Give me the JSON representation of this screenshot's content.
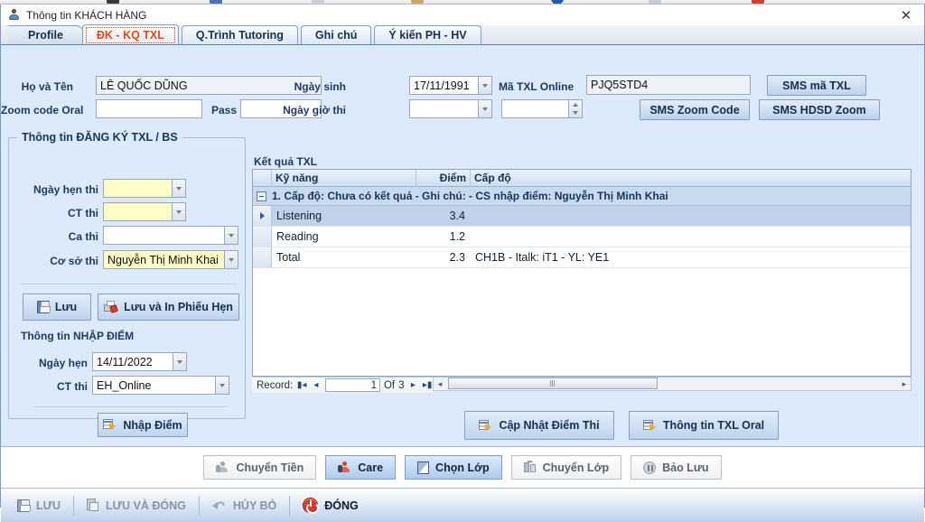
{
  "window": {
    "title": "Thông tin KHÁCH HÀNG",
    "user_icon": "user-icon",
    "close_icon": "close-icon"
  },
  "tabs": [
    {
      "label": "Profile",
      "active": false
    },
    {
      "label": "ĐK - KQ TXL",
      "active": true
    },
    {
      "label": "Q.Trình Tutoring",
      "active": false
    },
    {
      "label": "Ghi chú",
      "active": false
    },
    {
      "label": "Ý kiến PH - HV",
      "active": false
    }
  ],
  "form": {
    "name_label": "Họ và Tên",
    "name_value": "LÊ QUỐC DŨNG",
    "zoom_code_oral_label": "Zoom code Oral",
    "zoom_code_oral_value": "",
    "pass_label": "Pass",
    "pass_value": "",
    "dob_label": "Ngày sinh",
    "dob_value": "17/11/1991",
    "exam_datetime_label": "Ngày giờ thi",
    "exam_date_value": "",
    "exam_time_value": "",
    "txl_online_label": "Mã TXL Online",
    "txl_online_value": "PJQ5STD4"
  },
  "sms_buttons": {
    "sms_ma_txl": "SMS mã TXL",
    "sms_zoom_code": "SMS Zoom Code",
    "sms_hdsd_zoom": "SMS HDSD Zoom"
  },
  "registration": {
    "group_title": "Thông tin ĐĂNG KÝ TXL / BS",
    "fields": [
      {
        "label": "Ngày hẹn thi",
        "value": "",
        "style": "yellow"
      },
      {
        "label": "CT thi",
        "value": "",
        "style": "yellow"
      },
      {
        "label": "Ca thi",
        "value": "",
        "style": "white"
      },
      {
        "label": "Cơ sở thi",
        "value": "Nguyễn Thị Minh Khai",
        "style": "yellow"
      }
    ],
    "save_button": "Lưu",
    "save_print_button": "Lưu và In Phiếu Hẹn",
    "score_group_title": "Thông tin NHẬP ĐIỂM",
    "score_fields": [
      {
        "label": "Ngày hẹn",
        "value": "14/11/2022"
      },
      {
        "label": "CT thi",
        "value": "EH_Online"
      }
    ],
    "score_entry_button": "Nhập Điểm"
  },
  "results": {
    "group_title": "Kết quả TXL",
    "columns": [
      "Kỹ năng",
      "Điểm",
      "Cấp độ"
    ],
    "group_row": "1. Cấp độ: Chưa có kết quả - Ghi chú:  - CS nhập điểm: Nguyễn Thị Minh Khai",
    "rows": [
      {
        "skill": "Listening",
        "score": "3.4",
        "level": "",
        "selected": true
      },
      {
        "skill": "Reading",
        "score": "1.2",
        "level": "",
        "selected": false
      },
      {
        "skill": "Total",
        "score": "2.3",
        "level": "CH1B - Italk: iT1 - YL: YE1",
        "selected": false
      }
    ],
    "navigator": {
      "label": "Record:",
      "first_icon": "first-record-icon",
      "prev_icon": "previous-record-icon",
      "current": "1",
      "of_label": "Of",
      "total": "3",
      "next_icon": "next-record-icon",
      "last_icon": "last-record-icon"
    },
    "update_score_button": "Cập Nhật Điểm Thi",
    "txl_oral_button": "Thông tin TXL Oral"
  },
  "action_bar": [
    {
      "label": "Chuyển Tiền",
      "icon": "transfer-money-icon",
      "highlighted": false
    },
    {
      "label": "Care",
      "icon": "care-person-icon",
      "highlighted": true
    },
    {
      "label": "Chọn Lớp",
      "icon": "select-class-icon",
      "highlighted": true
    },
    {
      "label": "Chuyển Lớp",
      "icon": "transfer-class-icon",
      "highlighted": false
    },
    {
      "label": "Bảo Lưu",
      "icon": "reserve-pause-icon",
      "highlighted": false
    }
  ],
  "toolbar": [
    {
      "label": "LƯU",
      "icon": "save-icon",
      "state": "dim"
    },
    {
      "label": "LƯU VÀ ĐÓNG",
      "icon": "save-and-close-icon",
      "state": "dim"
    },
    {
      "label": "HỦY BỎ",
      "icon": "undo-icon",
      "state": "dim"
    },
    {
      "label": "ĐÓNG",
      "icon": "power-close-icon",
      "state": "strong"
    }
  ]
}
